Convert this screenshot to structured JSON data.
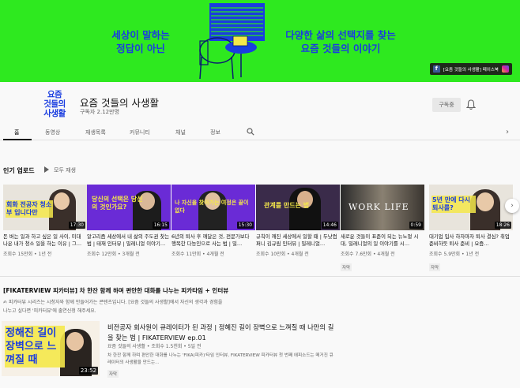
{
  "banner": {
    "left_line1": "세상이 말하는",
    "left_line2": "정답이 아닌",
    "right_line1": "다양한 삶의 선택지를 찾는",
    "right_line2": "요즘 것들의 이야기",
    "social_label": "[요즘 것들의 사생활] 페이스북"
  },
  "channel": {
    "logo_line1": "요즘",
    "logo_line2": "것들의",
    "logo_line3": "사생활",
    "title": "요즘 것들의 사생활",
    "subscribers": "구독자 2.12만명",
    "subscribe_label": "구독중"
  },
  "tabs": [
    {
      "label": "홈"
    },
    {
      "label": "동영상"
    },
    {
      "label": "재생목록"
    },
    {
      "label": "커뮤니티"
    },
    {
      "label": "채널"
    },
    {
      "label": "정보"
    }
  ],
  "popular": {
    "title": "인기 업로드",
    "play_all": "모두 재생",
    "videos": [
      {
        "title": "돈 버는 일과 하고 싶은 일 사이, 미대 나온 내가 청소 일을 하는 이유 | 그…",
        "meta": "조회수 15만회 • 1년 전",
        "duration": "17:30",
        "thumb_text": "회화 전공자 청소부 입니다만",
        "badge": ""
      },
      {
        "title": "알고리즘 세상에서 내 삶의 주도권 찾는 법 | 태재 인터뷰 | 밀레니얼 이야기…",
        "meta": "조회수 12만회 • 3개월 전",
        "duration": "16:15",
        "thumb_text": "당신의 선택은 당신의 것인가요?",
        "badge": ""
      },
      {
        "title": "6년의 퇴사 후 깨달은 것, 전문가보다 행복한 다능인으로 사는 법 | 밀…",
        "meta": "조회수 11만회 • 4개월 전",
        "duration": "15:30",
        "thumb_text": "나 자신을 찾아가는 여정은 끝이 없다",
        "badge": ""
      },
      {
        "title": "규칙이 깨진 세상에서 일할 때 | 두낫컴퍼니 김규림 인터뷰 | 밀레니얼…",
        "meta": "조회수 10만회 • 4개월 전",
        "duration": "14:46",
        "thumb_text": "관계를 만드는 법",
        "badge": ""
      },
      {
        "title": "새로운 것들이 표준이 되는 뉴노멀 시대, 밀레니얼의 일 이야기를 시…",
        "meta": "조회수 7.6만회 • 4개월 전",
        "duration": "0:59",
        "thumb_text": "WORK LIFE",
        "badge": "자막"
      },
      {
        "title": "대기업 입사 하자마자 퇴사 결심? 취업 준비하듯 퇴사 준비 | 요즘…",
        "meta": "조회수 5.9만회 • 1년 전",
        "duration": "18:26",
        "thumb_text": "5년 만에 다시 퇴사를?",
        "badge": "자막"
      }
    ]
  },
  "playlist": {
    "title": "[FIKATERVIEW 피카터뷰] 차 한잔 함께 하며 편안한 대화를 나누는 피카타임 + 인터뷰",
    "desc_line1": "✍ 피카터뷰 시리즈는 시청자와 함께 만들어가는 콘텐츠입니다. [요즘 것들의 사생활]에서 자신의 생각과 경험을",
    "desc_line2": "나누고 싶다면 '피카터뷰'에 출연신청 해주세요."
  },
  "featured": {
    "title": "비전공자 회사원이 큐레이터가 된 과정 | 정혜진 길이 장벽으로 느껴질 때 나만의 길을 찾는 법 | FIKATERVIEW ep.01",
    "meta": "요즘 것들의 사생활 • 조회수 1.5천회 • 5일 전",
    "desc": "차 한잔 함께 하며 편안한 대화를 나누는 'FIKA(피카)'타임 인터뷰, FIKATERVIEW 피카터뷰 첫 번째 에피소드는 메거진 큐레이터의 사생활을 만드는...",
    "duration": "23:52",
    "thumb_text": "정해진 길이 장벽으로 느껴질 때",
    "badge": "자막"
  },
  "colors": {
    "banner_green": "#2ee91f",
    "brand_blue": "#1a3de0",
    "thumb_purple": "#6a2bd6",
    "highlight_yellow": "#f5e84a"
  }
}
